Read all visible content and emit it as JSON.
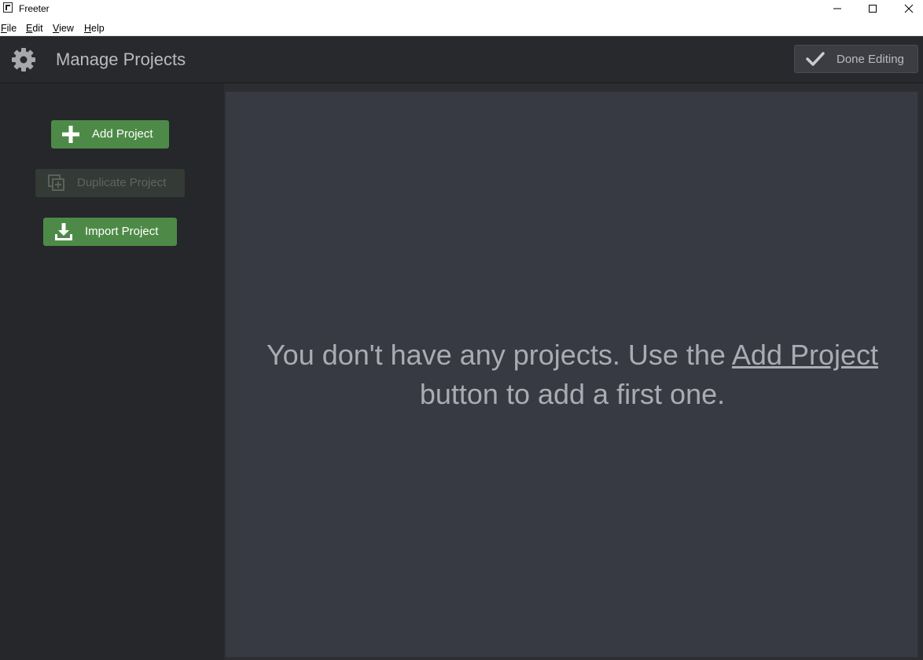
{
  "window": {
    "title": "Freeter",
    "icon": "freeter-logo-icon",
    "controls": [
      "minimize-icon",
      "maximize-icon",
      "close-icon"
    ]
  },
  "menu": {
    "items": [
      {
        "label": "File",
        "mnemonic": "F",
        "rest": "ile"
      },
      {
        "label": "Edit",
        "mnemonic": "E",
        "rest": "dit"
      },
      {
        "label": "View",
        "mnemonic": "V",
        "rest": "iew"
      },
      {
        "label": "Help",
        "mnemonic": "H",
        "rest": "elp"
      }
    ]
  },
  "header": {
    "icon": "gear-icon",
    "title": "Manage Projects",
    "done_button": {
      "label": "Done Editing",
      "icon": "checkmark-icon"
    }
  },
  "sidebar": {
    "buttons": [
      {
        "label": "Add Project",
        "icon": "plus-icon",
        "enabled": true
      },
      {
        "label": "Duplicate Project",
        "icon": "duplicate-icon",
        "enabled": false
      },
      {
        "label": "Import Project",
        "icon": "download-icon",
        "enabled": true
      }
    ]
  },
  "main": {
    "empty_message": {
      "before": "You don't have any projects. Use the ",
      "link": "Add Project",
      "after": " button to add a first one."
    }
  },
  "colors": {
    "accent_green": "#4e8a47",
    "header_bg": "#27292d",
    "sidebar_bg": "#25272b",
    "panel_bg": "#373a42",
    "text_muted": "#a9acb2"
  }
}
